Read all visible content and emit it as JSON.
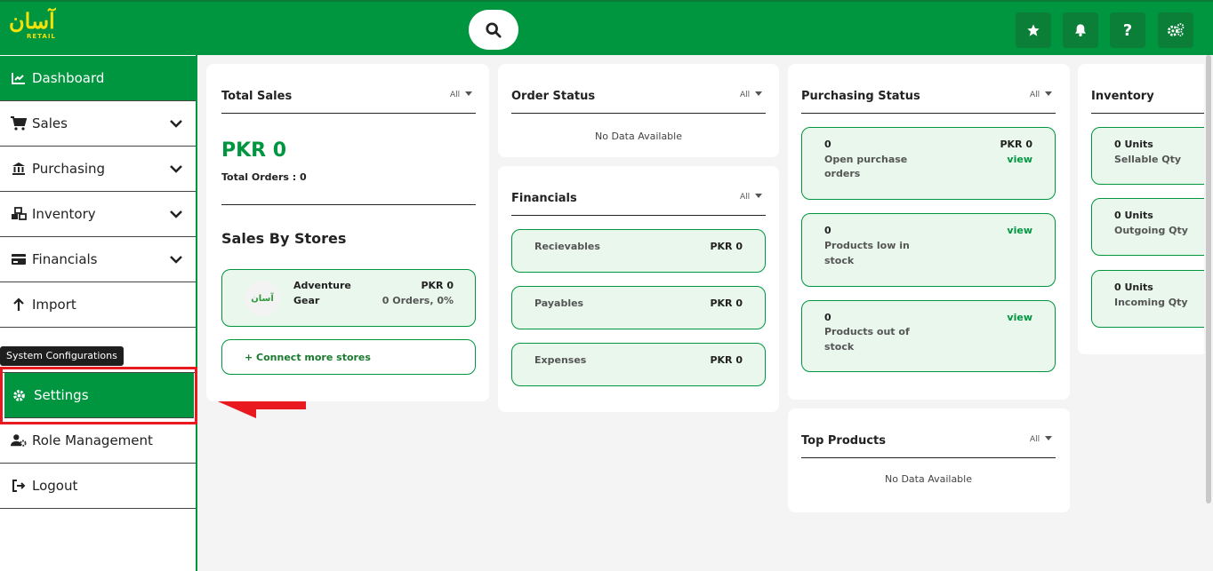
{
  "app": {
    "logo_urdu": "آسان",
    "logo_sub": "RETAIL"
  },
  "icons": {
    "search": "search-icon",
    "favorites": "star-icon",
    "notifications": "bell-icon",
    "help": "question-icon",
    "system": "gears-icon"
  },
  "colors": {
    "brand": "#00963f",
    "highlight": "#e8191f",
    "panel_fill": "#e9f7ec"
  },
  "topbar": {
    "help_label": "?"
  },
  "sidebar": {
    "items": [
      {
        "label": "Dashboard",
        "icon": "chart-line-icon",
        "active": true
      },
      {
        "label": "Sales",
        "icon": "cart-icon",
        "expandable": true
      },
      {
        "label": "Purchasing",
        "icon": "bank-icon",
        "expandable": true
      },
      {
        "label": "Inventory",
        "icon": "cubes-icon",
        "expandable": true
      },
      {
        "label": "Financials",
        "icon": "credit-card-icon",
        "expandable": true
      },
      {
        "label": "Import",
        "icon": "arrow-up-icon"
      },
      {
        "label": "Settings",
        "icon": "gear-icon",
        "active": true
      },
      {
        "label": "Role Management",
        "icon": "user-gear-icon"
      },
      {
        "label": "Logout",
        "icon": "sign-out-icon"
      }
    ],
    "tooltip": "System Configurations"
  },
  "total_sales": {
    "title": "Total Sales",
    "filter": "All",
    "amount": "PKR 0",
    "orders": "Total Orders : 0",
    "stores_title": "Sales By Stores",
    "store": {
      "name_line1": "Adventure",
      "name_line2": "Gear",
      "amount": "PKR 0",
      "orders": "0 Orders, 0%"
    },
    "connect_label": "+ Connect more stores"
  },
  "order_status": {
    "title": "Order Status",
    "filter": "All",
    "empty": "No Data Available"
  },
  "financials": {
    "title": "Financials",
    "filter": "All",
    "rows": [
      {
        "label": "Recievables",
        "value": "PKR 0"
      },
      {
        "label": "Payables",
        "value": "PKR 0"
      },
      {
        "label": "Expenses",
        "value": "PKR 0"
      }
    ]
  },
  "purchasing_status": {
    "title": "Purchasing Status",
    "filter": "All",
    "rows": [
      {
        "count": "0",
        "line1": "Open purchase",
        "line2": "orders",
        "amount": "PKR 0",
        "link": "view"
      },
      {
        "count": "0",
        "line1": "Products low in",
        "line2": "stock",
        "link": "view"
      },
      {
        "count": "0",
        "line1": "Products out of",
        "line2": "stock",
        "link": "view"
      }
    ]
  },
  "top_products": {
    "title": "Top Products",
    "filter": "All",
    "empty": "No Data Available"
  },
  "inventory": {
    "title": "Inventory",
    "rows": [
      {
        "value": "0 Units",
        "label": "Sellable Qty"
      },
      {
        "value": "0 Units",
        "label": "Outgoing Qty"
      },
      {
        "value": "0 Units",
        "label": "Incoming Qty"
      }
    ]
  }
}
